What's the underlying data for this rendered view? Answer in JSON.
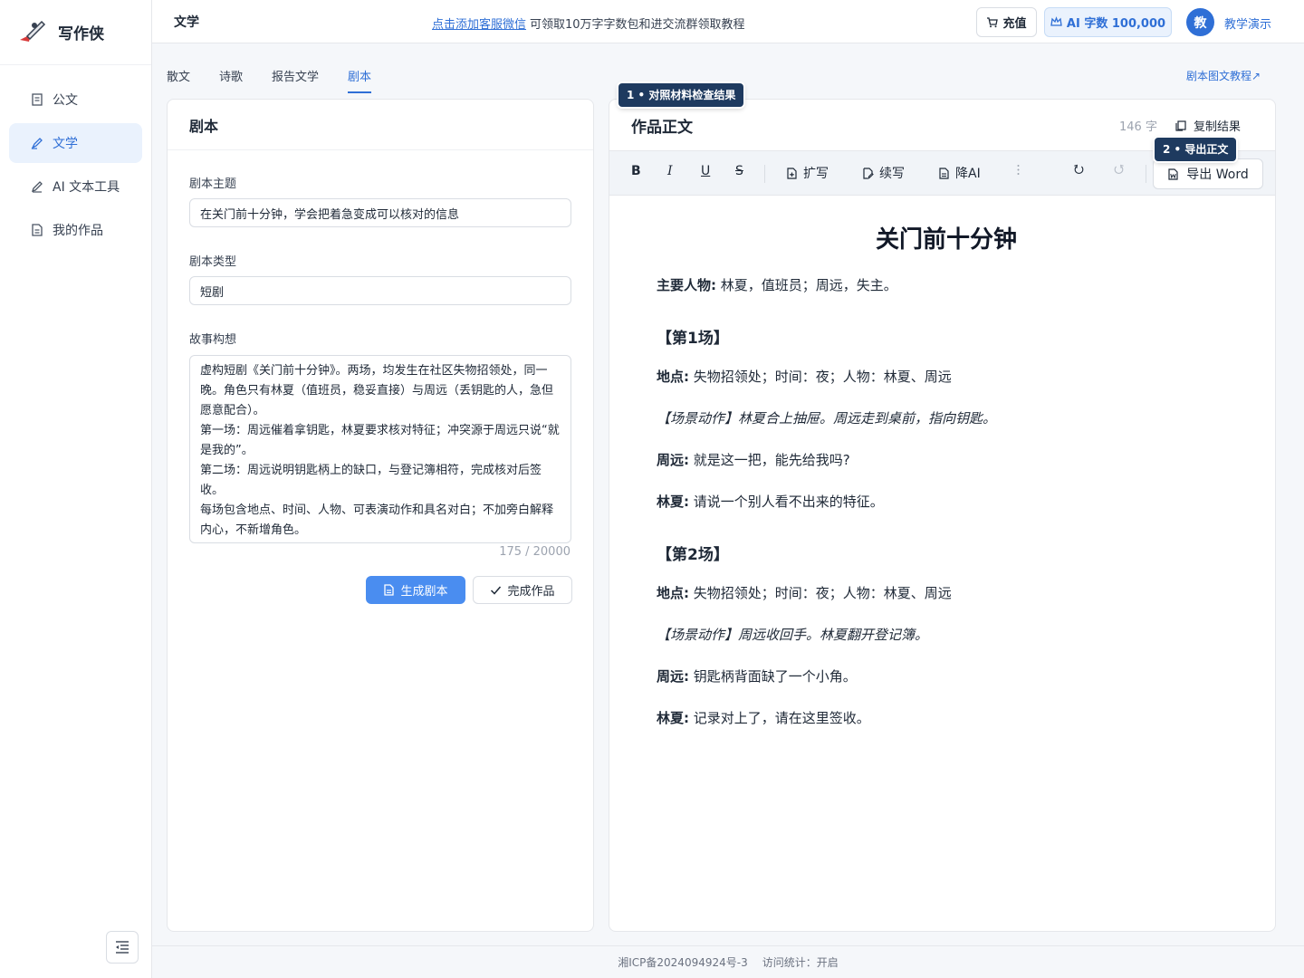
{
  "app": {
    "name": "写作侠"
  },
  "sidebar": {
    "items": [
      {
        "label": "公文",
        "icon": "document-icon"
      },
      {
        "label": "文学",
        "icon": "pen-icon",
        "active": true
      },
      {
        "label": "AI 文本工具",
        "icon": "edit-icon"
      },
      {
        "label": "我的作品",
        "icon": "file-icon"
      }
    ]
  },
  "header": {
    "title": "文学",
    "notice_link": "点击添加客服微信",
    "notice_text": "可领取10万字字数包和进交流群领取教程",
    "recharge_label": "充值",
    "ai_quota_label": "AI 字数 100,000",
    "avatar_text": "教",
    "user_name": "教学演示"
  },
  "tabs": [
    {
      "label": "散文"
    },
    {
      "label": "诗歌"
    },
    {
      "label": "报告文学"
    },
    {
      "label": "剧本",
      "active": true
    }
  ],
  "tutorial_link": "剧本图文教程↗",
  "form": {
    "title": "剧本",
    "topic_label": "剧本主题",
    "topic_value": "在关门前十分钟，学会把着急变成可以核对的信息",
    "type_label": "剧本类型",
    "type_value": "短剧",
    "story_label": "故事构想",
    "story_value": "虚构短剧《关门前十分钟》。两场，均发生在社区失物招领处，同一晚。角色只有林夏（值班员，稳妥直接）与周远（丢钥匙的人，急但愿意配合）。\n第一场：周远催着拿钥匙，林夏要求核对特征；冲突源于周远只说“就是我的”。\n第二场：周远说明钥匙柄上的缺口，与登记簿相符，完成核对后签收。\n每场包含地点、时间、人物、可表演动作和具名对白；不加旁白解释内心，不新增角色。",
    "counter": "175 / 20000",
    "generate_label": "生成剧本",
    "done_label": "完成作品"
  },
  "editor": {
    "title": "作品正文",
    "word_count": "146 字",
    "copy_label": "复制结果",
    "toolbar": {
      "bold": "B",
      "italic": "I",
      "underline": "U",
      "strike": "S",
      "expand": "扩写",
      "continue": "续写",
      "reduce_ai": "降AI",
      "export_word": "导出 Word"
    },
    "doc": {
      "title": "关门前十分钟",
      "characters_label": "主要人物:",
      "characters_text": "林夏，值班员；周远，失主。",
      "scene1": {
        "title": "【第1场】",
        "place_label": "地点:",
        "place_text": "失物招领处；时间：夜；人物：林夏、周远",
        "action": "【场景动作】林夏合上抽屉。周远走到桌前，指向钥匙。",
        "line1_speaker": "周远:",
        "line1_text": "就是这一把，能先给我吗?",
        "line2_speaker": "林夏:",
        "line2_text": "请说一个别人看不出来的特征。"
      },
      "scene2": {
        "title": "【第2场】",
        "place_label": "地点:",
        "place_text": "失物招领处；时间：夜；人物：林夏、周远",
        "action": "【场景动作】周远收回手。林夏翻开登记簿。",
        "line1_speaker": "周远:",
        "line1_text": "钥匙柄背面缺了一个小角。",
        "line2_speaker": "林夏:",
        "line2_text": "记录对上了，请在这里签收。"
      }
    }
  },
  "badges": {
    "b1": "1 • 对照材料检查结果",
    "b2": "2 • 导出正文"
  },
  "footer": {
    "icp": "湘ICP备2024094924号-3",
    "stats": "访问统计：开启"
  },
  "colors": {
    "accent": "#2f6fd6",
    "badge": "#1e3a5f"
  }
}
